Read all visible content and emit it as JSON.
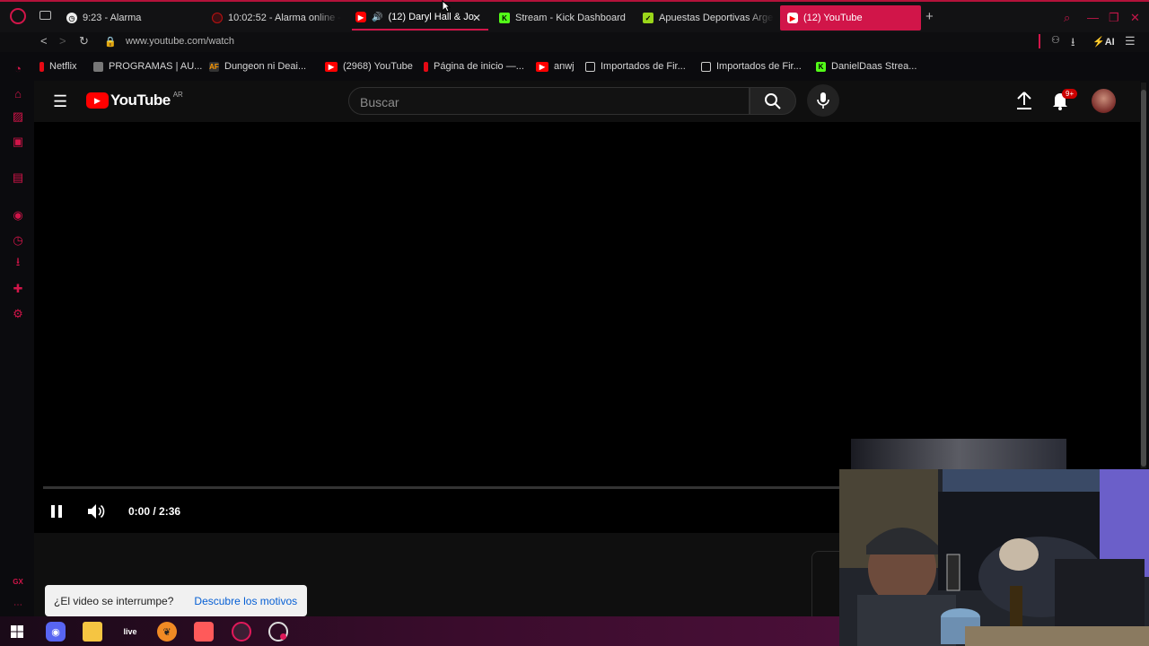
{
  "browser": {
    "tabs": [
      {
        "label": "9:23 - Alarma",
        "icon": "clock-icon"
      },
      {
        "label": "10:02:52 - Alarma online -",
        "icon": "alarm-icon"
      },
      {
        "label": "(12) Daryl Hall & Jo",
        "icon": "youtube-icon",
        "audio": "speaker-icon"
      },
      {
        "label": "Stream - Kick Dashboard",
        "icon": "kick-icon"
      },
      {
        "label": "Apuestas Deportivas Arge",
        "icon": "betting-icon"
      },
      {
        "label": "(12) YouTube",
        "icon": "youtube-icon"
      }
    ],
    "url": "www.youtube.com/watch",
    "ai_label": "AI",
    "bookmarks": [
      {
        "label": "Netflix",
        "icon": "netflix-icon"
      },
      {
        "label": "PROGRAMAS | AU...",
        "icon": "bookmark-image-icon"
      },
      {
        "label": "Dungeon ni Deai...",
        "icon": "anime-site-icon"
      },
      {
        "label": "(2968) YouTube",
        "icon": "youtube-icon"
      },
      {
        "label": "Página de inicio —...",
        "icon": "netflix-icon"
      },
      {
        "label": "anwj",
        "icon": "youtube-icon"
      },
      {
        "label": "Importados de Fir...",
        "icon": "folder-icon"
      },
      {
        "label": "Importados de Fir...",
        "icon": "folder-icon"
      },
      {
        "label": "DanielDaas Strea...",
        "icon": "kick-icon"
      }
    ],
    "sidebar_gx_label": "GX",
    "accent": "#d11549"
  },
  "youtube": {
    "logo_text": "YouTube",
    "region": "AR",
    "search_placeholder": "Buscar",
    "notification_count": "9+",
    "player": {
      "time": "0:00 / 2:36",
      "progress_fraction": 0.0
    },
    "toast": {
      "question": "¿El video se interrumpe?",
      "link": "Descubre los motivos"
    }
  },
  "taskbar": {
    "items": [
      "windows-start-icon",
      "discord-icon",
      "file-explorer-icon",
      "live-icon",
      "fl-studio-icon",
      "app-icon",
      "opera-gx-icon",
      "opera-gx-alt-icon"
    ],
    "live_label": "live"
  }
}
